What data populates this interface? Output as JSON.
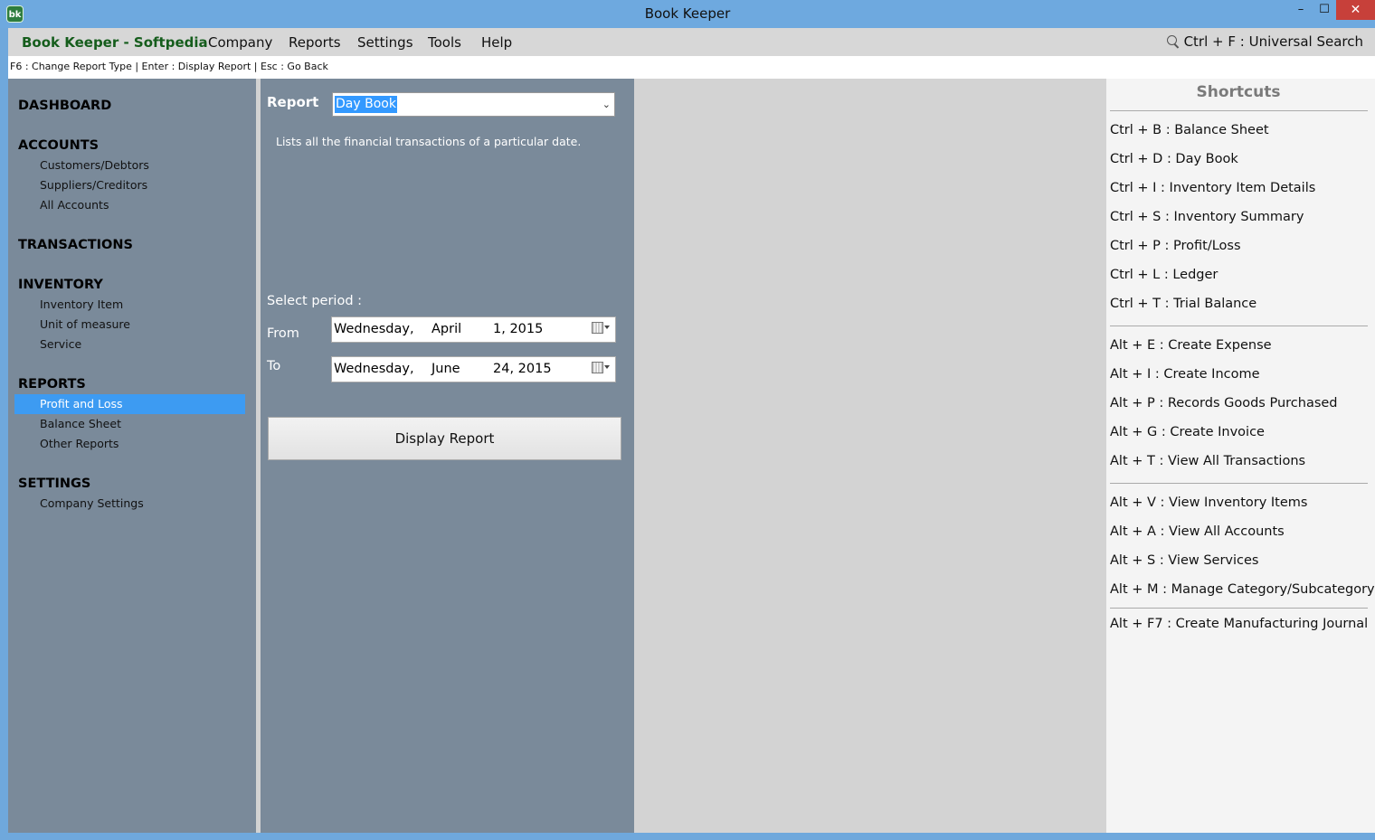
{
  "window": {
    "title": "Book Keeper",
    "logo_text": "bk",
    "minimize": "–",
    "maximize": "☐",
    "close": "✕"
  },
  "menu": {
    "brand": "Book Keeper - Softpedia",
    "items": [
      "Company",
      "Reports",
      "Settings",
      "Tools",
      "Help"
    ],
    "search_hint": "Ctrl + F  : Universal Search"
  },
  "hint_bar": "F6 : Change Report Type | Enter : Display Report | Esc : Go Back",
  "sidebar": {
    "dashboard": "DASHBOARD",
    "accounts": "ACCOUNTS",
    "accounts_items": [
      "Customers/Debtors",
      "Suppliers/Creditors",
      "All Accounts"
    ],
    "transactions": "TRANSACTIONS",
    "inventory": "INVENTORY",
    "inventory_items": [
      "Inventory Item",
      "Unit of measure",
      "Service"
    ],
    "reports": "REPORTS",
    "reports_items": [
      "Profit and Loss",
      "Balance Sheet",
      "Other Reports"
    ],
    "settings": "SETTINGS",
    "settings_items": [
      "Company Settings"
    ]
  },
  "report_panel": {
    "report_label": "Report",
    "selected_report": "Day Book",
    "description": "Lists all the financial transactions of a particular date.",
    "period_label": "Select period :",
    "from_label": "From",
    "to_label": "To",
    "from_date": {
      "day": "Wednesday,",
      "month": "April",
      "date": "1, 2015"
    },
    "to_date": {
      "day": "Wednesday,",
      "month": "June",
      "date": "24, 2015"
    },
    "display_button": "Display Report"
  },
  "shortcuts": {
    "title": "Shortcuts",
    "group1": [
      "Ctrl + B : Balance Sheet",
      "Ctrl + D : Day Book",
      "Ctrl + I  : Inventory Item Details",
      "Ctrl + S : Inventory Summary",
      "Ctrl + P : Profit/Loss",
      "Ctrl + L : Ledger",
      "Ctrl + T : Trial Balance"
    ],
    "group2": [
      "Alt + E : Create Expense",
      "Alt + I  : Create Income",
      "Alt + P : Records Goods Purchased",
      "Alt + G : Create Invoice",
      "Alt + T : View All Transactions"
    ],
    "group3": [
      "Alt + V : View Inventory Items",
      "Alt + A : View All Accounts",
      "Alt + S : View Services",
      "Alt + M : Manage Category/Subcategory"
    ],
    "group4": [
      "Alt + F7 : Create Manufacturing Journal"
    ]
  },
  "colors": {
    "titlebar": "#6ea9df",
    "brand": "#155d1c",
    "panel": "#7a8a9a",
    "active_item": "#3d9bf2",
    "close_button": "#c7403a"
  }
}
